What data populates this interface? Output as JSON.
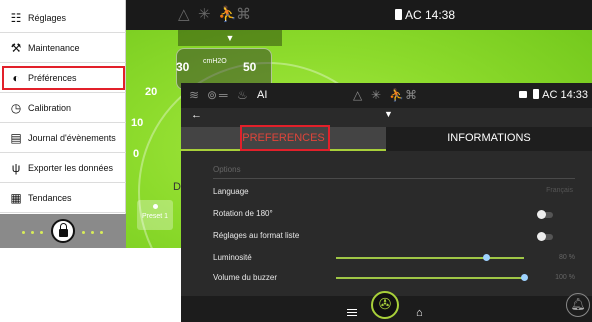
{
  "side_menu": {
    "items": [
      {
        "label": "Réglages",
        "icon": "sliders-icon",
        "glyph": "☷"
      },
      {
        "label": "Maintenance",
        "icon": "wrench-icon",
        "glyph": "🔧"
      },
      {
        "label": "Préférences",
        "icon": "contrast-icon",
        "glyph": "◐"
      },
      {
        "label": "Calibration",
        "icon": "gauge-icon",
        "glyph": "◷"
      },
      {
        "label": "Journal d'évènements",
        "icon": "log-icon",
        "glyph": "▤"
      },
      {
        "label": "Exporter les données",
        "icon": "usb-icon",
        "glyph": "ψ"
      },
      {
        "label": "Tendances",
        "icon": "grid-icon",
        "glyph": "▦"
      }
    ],
    "selected": "Préférences"
  },
  "back_screen": {
    "status": "AC 14:38",
    "gauge_unit": "cmH2O",
    "gauge_left": "30",
    "gauge_right": "50",
    "scale": [
      "20",
      "10",
      "0"
    ],
    "letter": "D",
    "preset_label": "Preset 1"
  },
  "front_screen": {
    "mode_label": "AI",
    "status": "AC 14:33",
    "tabs": {
      "preferences": "PREFERENCES",
      "informations": "INFORMATIONS"
    },
    "section_header": "Options",
    "rows": {
      "language_label": "Language",
      "language_value": "Français",
      "rotation_label": "Rotation de 180°",
      "list_format_label": "Réglages au format liste",
      "brightness_label": "Luminosité",
      "brightness_value": "80 %",
      "buzzer_label": "Volume du buzzer",
      "buzzer_value": "100 %"
    },
    "brightness_level": 0.8,
    "buzzer_level": 1.0
  },
  "colors": {
    "accent_green": "#a8d03a",
    "highlight_red": "#e2202a",
    "tab_active_text": "#e0443a"
  }
}
